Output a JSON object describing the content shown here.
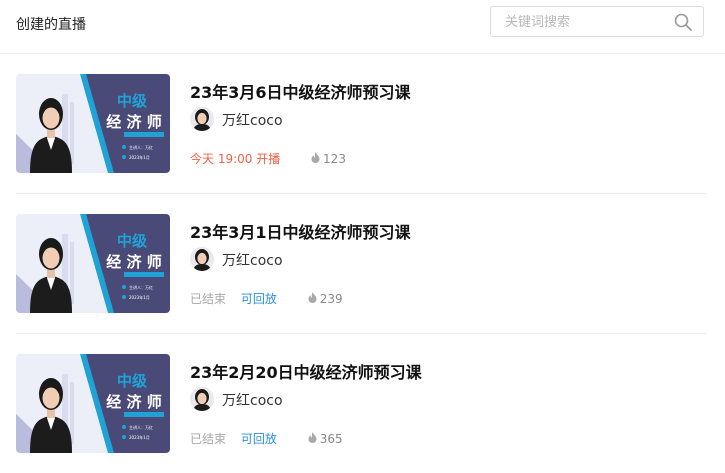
{
  "header": {
    "title": "创建的直播",
    "search_placeholder": "关键词搜索"
  },
  "thumbnail": {
    "badge_line1": "中级",
    "badge_line2": "经 济 师",
    "lecturer": "主讲人：万红",
    "year": "2023年1月",
    "colors": {
      "panel": "#4a4a78",
      "accent": "#1fa2d6",
      "bg": "#eceef8"
    }
  },
  "items": [
    {
      "title": "23年3月6日中级经济师预习课",
      "host": "万红coco",
      "status": "今天 19:00 开播",
      "replay": "",
      "views": "123"
    },
    {
      "title": "23年3月1日中级经济师预习课",
      "host": "万红coco",
      "status": "已结束",
      "replay": "可回放",
      "views": "239"
    },
    {
      "title": "23年2月20日中级经济师预习课",
      "host": "万红coco",
      "status": "已结束",
      "replay": "可回放",
      "views": "365"
    }
  ]
}
